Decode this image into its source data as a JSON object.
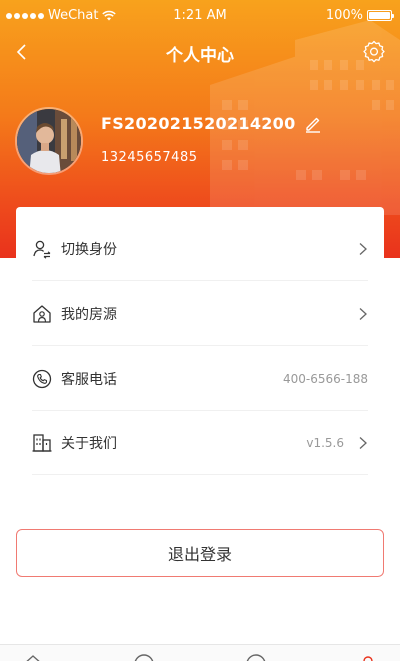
{
  "status_bar": {
    "carrier": "WeChat",
    "time": "1:21 AM",
    "battery": "100%"
  },
  "nav": {
    "title": "个人中心",
    "back_icon": "chevron-left-icon",
    "settings_icon": "gear-icon"
  },
  "profile": {
    "username": "FS202021520214200",
    "phone": "13245657485",
    "edit_icon": "pencil-icon"
  },
  "menu": {
    "items": [
      {
        "label": "切换身份",
        "value": "",
        "icon": "user-switch-icon",
        "arrow": true
      },
      {
        "label": "我的房源",
        "value": "",
        "icon": "house-icon",
        "arrow": true
      },
      {
        "label": "客服电话",
        "value": "400-6566-188",
        "icon": "phone-icon",
        "arrow": false
      },
      {
        "label": "关于我们",
        "value": "v1.5.6",
        "icon": "building-icon",
        "arrow": true
      }
    ]
  },
  "logout_label": "退出登录",
  "colors": {
    "gradient_top": "#f8a21c",
    "gradient_bottom": "#e9321c",
    "logout_border": "#f07a72"
  }
}
